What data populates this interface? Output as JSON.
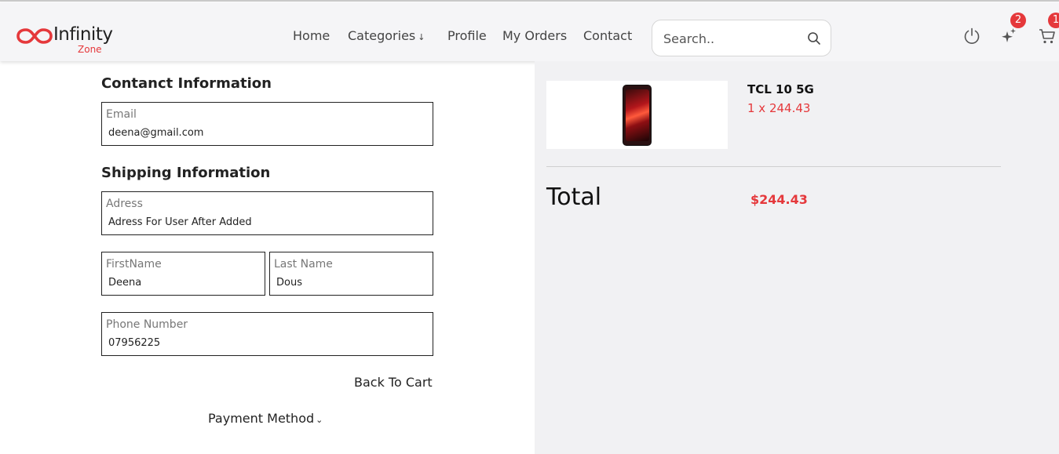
{
  "brand": {
    "name": "Infinity",
    "sub": "Zone",
    "accent": "#e5383b"
  },
  "nav": {
    "home": "Home",
    "categories": "Categories",
    "categories_icon": "arrow-down",
    "profile": "Profile",
    "orders": "My Orders",
    "contact": "Contact"
  },
  "search": {
    "placeholder": "Search.."
  },
  "header_icons": {
    "power": "power-icon",
    "wishlist": "sparkle-icon",
    "wishlist_count": "2",
    "cart": "cart-icon",
    "cart_count": "1"
  },
  "contact_section": {
    "title": "Contanct Information",
    "email_label": "Email",
    "email_value": "deena@gmail.com"
  },
  "shipping_section": {
    "title": "Shipping Information",
    "address_label": "Adress",
    "address_value": "Adress For User After Added",
    "first_name_label": "FirstName",
    "first_name_value": "Deena",
    "last_name_label": "Last Name",
    "last_name_value": "Dous",
    "phone_label": "Phone Number",
    "phone_value": "07956225"
  },
  "actions": {
    "back_to_cart": "Back To Cart",
    "payment_method": "Payment Method"
  },
  "order": {
    "item_name": "TCL 10 5G",
    "item_qty_price": "1 x 244.43",
    "total_label": "Total",
    "total_value": "$244.43"
  }
}
